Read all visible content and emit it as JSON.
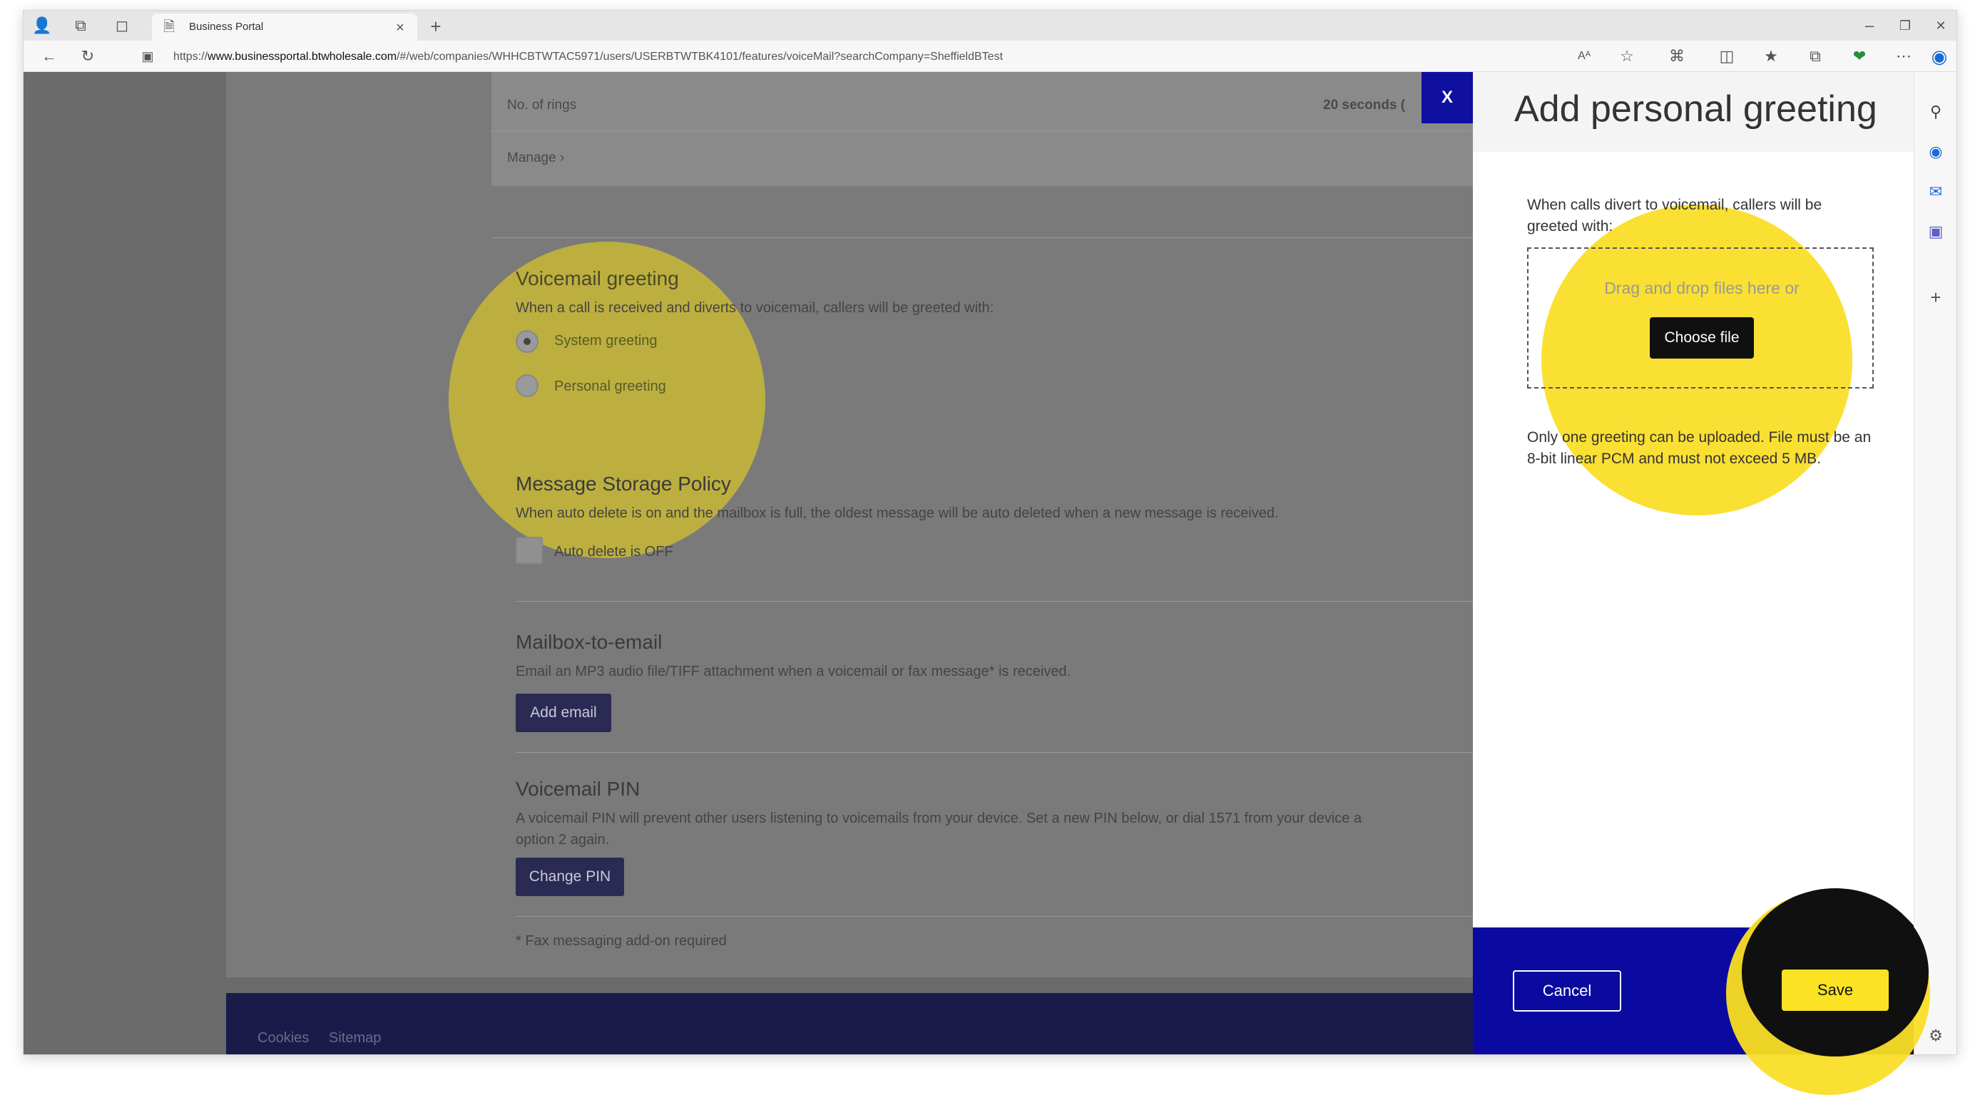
{
  "browser": {
    "tab_title": "Business Portal",
    "tab_close": "×",
    "new_tab": "+",
    "url_prefix": "https://",
    "url_host": "www.businessportal.btwholesale.com",
    "url_path": "/#/web/companies/WHHCBTWTAC5971/users/USERBTWTBK4101/features/voiceMail?searchCompany=SheffieldBTest",
    "read_aloud": "Aᴬ",
    "window_min": "–",
    "window_restore": "❐",
    "window_close": "✕"
  },
  "page": {
    "card": {
      "rings_label": "No. of rings",
      "rings_value": "20 seconds (",
      "manage_link": "Manage ›"
    },
    "voicemail_greeting": {
      "heading": "Voicemail greeting",
      "description": "When a call is received and diverts to voicemail, callers will be greeted with:",
      "options": [
        {
          "label": "System greeting",
          "selected": true
        },
        {
          "label": "Personal greeting",
          "selected": false
        }
      ]
    },
    "storage_policy": {
      "heading": "Message Storage Policy",
      "description": "When auto delete is on and the mailbox is full, the oldest message will be auto deleted when a new message is received.",
      "checkbox_label": "Auto delete is OFF"
    },
    "mailbox_to_email": {
      "heading": "Mailbox-to-email",
      "description": "Email an MP3 audio file/TIFF attachment when a voicemail or fax message* is received.",
      "button": "Add email"
    },
    "voicemail_pin": {
      "heading": "Voicemail PIN",
      "description_line1": "A voicemail PIN will prevent other users listening to voicemails from your device. Set a new PIN below, or dial 1571 from your device a",
      "description_line2": "option 2 again.",
      "button": "Change PIN"
    },
    "footnote": "* Fax messaging add-on required",
    "footer": {
      "links": [
        "Cookies",
        "Sitemap"
      ]
    }
  },
  "panel": {
    "close_label": "X",
    "title": "Add personal greeting",
    "intro": "When calls divert to voicemail, callers will be greeted with:",
    "drop_text": "Drag and drop files here or",
    "choose_file": "Choose file",
    "note": "Only one greeting can be uploaded. File must be an 8-bit linear PCM and must not exceed 5 MB.",
    "cancel": "Cancel",
    "save": "Save"
  },
  "colors": {
    "highlight": "#f5dc1e",
    "panel_footer": "#0a0aa0",
    "save_button": "#fbe223",
    "overlay_page": "#6b6b6b"
  },
  "icons": [
    "profile-icon",
    "workspaces-icon",
    "tab-actions-icon",
    "page-icon",
    "back-icon",
    "refresh-icon",
    "lock-icon",
    "read-aloud-icon",
    "favorite-icon",
    "extensions-icon",
    "split-screen-icon",
    "favorites-icon",
    "collections-icon",
    "copilot-icon",
    "search-icon",
    "settings-icon"
  ]
}
